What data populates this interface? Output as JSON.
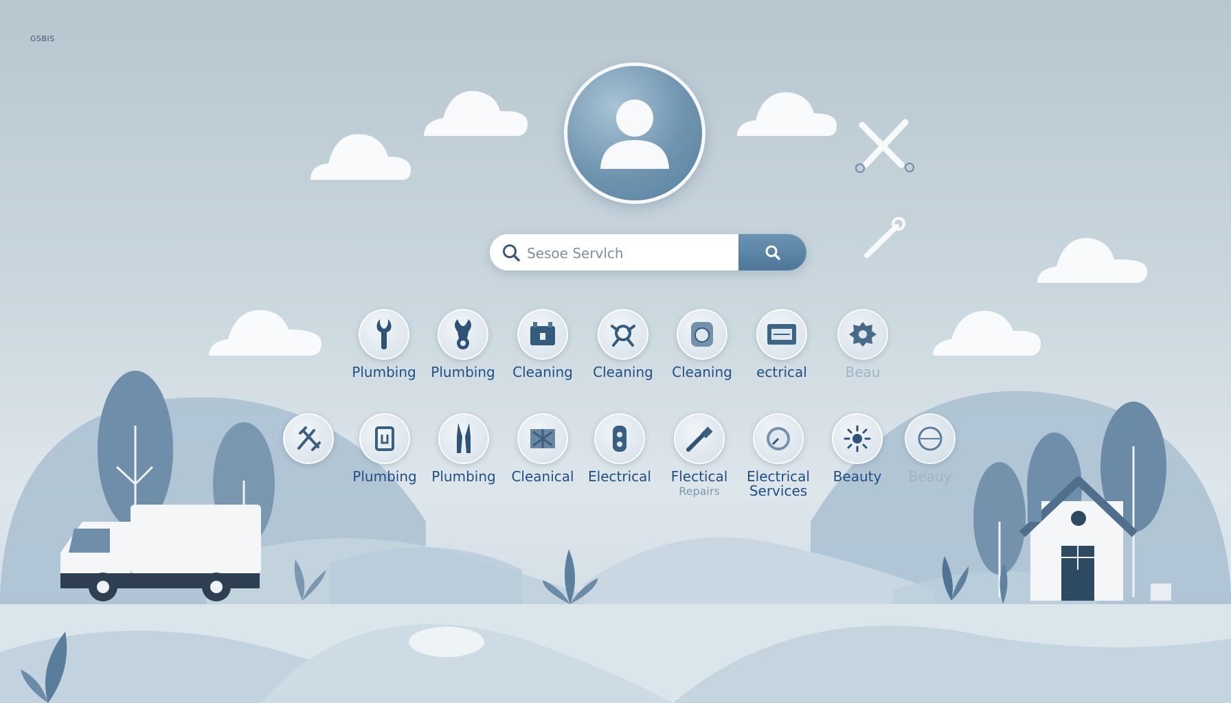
{
  "corner_label": "GSBIS",
  "search": {
    "placeholder": "Sesoe Servlch",
    "icon": "search-icon",
    "button_icon": "search-icon"
  },
  "colors": {
    "accent": "#4d7698",
    "label": "#1f4f82",
    "background": "#c9d6dd"
  },
  "services_row1": [
    {
      "label": "Plumbing",
      "icon": "wrench-icon"
    },
    {
      "label": "Plumbing",
      "icon": "pipe-wrench-icon"
    },
    {
      "label": "Cleaning",
      "icon": "bucket-icon"
    },
    {
      "label": "Cleaning",
      "icon": "vacuum-icon"
    },
    {
      "label": "Cleaning",
      "icon": "washer-icon"
    },
    {
      "label": "ectrical",
      "icon": "panel-icon"
    },
    {
      "label": "Beau",
      "icon": "gear-icon"
    }
  ],
  "services_row2": [
    {
      "label": "",
      "icon": "tools-icon"
    },
    {
      "label": "Plumbing",
      "icon": "plug-icon"
    },
    {
      "label": "Plumbing",
      "icon": "pliers-icon"
    },
    {
      "label": "Cleanical",
      "icon": "brush-icon"
    },
    {
      "label": "Electrical",
      "icon": "socket-icon"
    },
    {
      "label": "Flectical",
      "label2": "Repairs",
      "icon": "screwdriver-icon"
    },
    {
      "label": "Electrical",
      "label2": "Services",
      "icon": "meter-icon"
    },
    {
      "label": "Beauty",
      "icon": "sun-icon"
    },
    {
      "label": "Beauy",
      "icon": "mirror-icon"
    }
  ]
}
